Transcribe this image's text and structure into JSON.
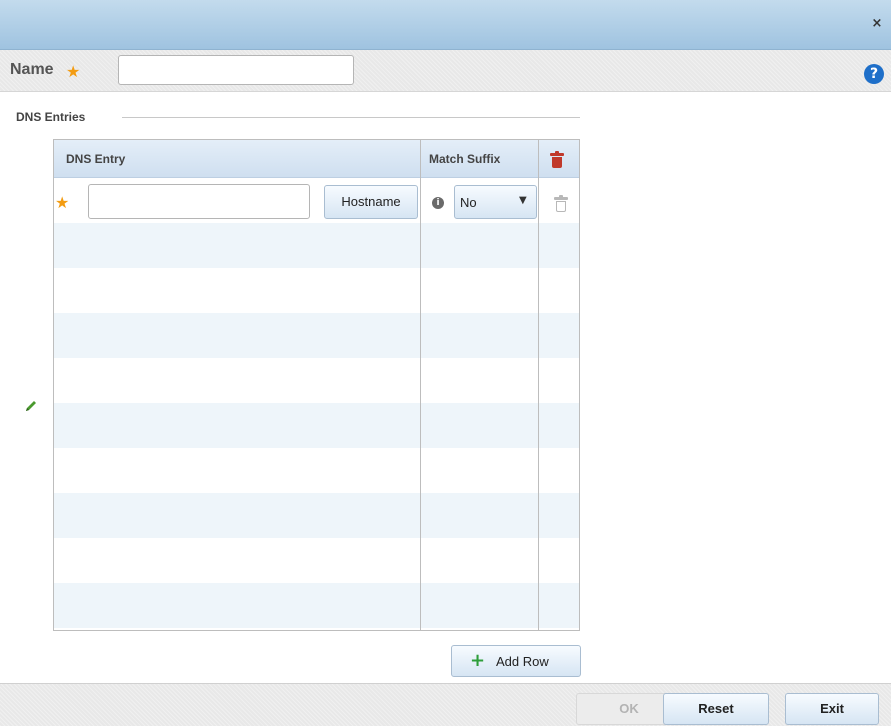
{
  "window": {
    "close_glyph": "×"
  },
  "name_field": {
    "label": "Name",
    "required_glyph": "★",
    "value": ""
  },
  "help": {
    "glyph": "?"
  },
  "dns_entries": {
    "group_label": "DNS Entries",
    "columns": {
      "entry": "DNS Entry",
      "match_suffix": "Match Suffix"
    },
    "rows": [
      {
        "required_glyph": "★",
        "entry_value": "",
        "type_button": "Hostname",
        "info_glyph": "i",
        "match_suffix_value": "No",
        "dropdown_glyph": "▼"
      }
    ],
    "add_row": {
      "plus_glyph": "+",
      "label": "Add Row"
    }
  },
  "footer": {
    "ok_label": "OK",
    "reset_label": "Reset",
    "exit_label": "Exit"
  },
  "colors": {
    "title_bar": "#9fc3e0",
    "required_star": "#f39c12",
    "delete_red": "#c0392b",
    "help_blue": "#1e6fc9",
    "add_green": "#2e9e3a"
  }
}
